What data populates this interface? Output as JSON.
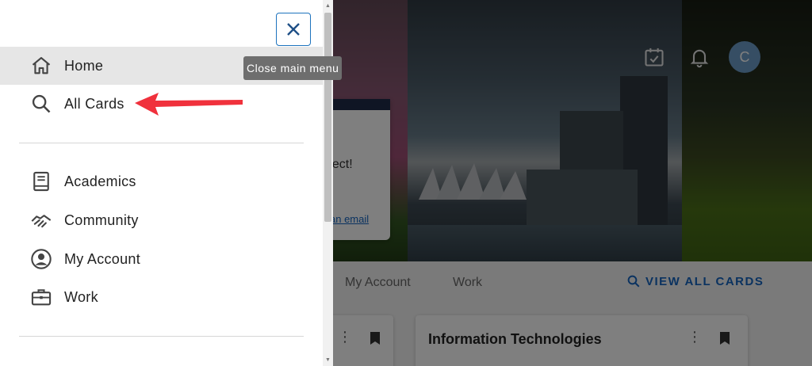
{
  "drawer": {
    "close_tooltip": "Close main menu",
    "items": [
      {
        "label": "Home",
        "icon": "home-icon"
      },
      {
        "label": "All Cards",
        "icon": "search-icon"
      },
      {
        "label": "Academics",
        "icon": "book-icon"
      },
      {
        "label": "Community",
        "icon": "handshake-icon"
      },
      {
        "label": "My Account",
        "icon": "account-circle-icon"
      },
      {
        "label": "Work",
        "icon": "briefcase-icon"
      }
    ]
  },
  "background": {
    "connect_fragment": "nect!",
    "email_fragment": "an email",
    "avatar_initial": "C",
    "tabs": [
      "My Account",
      "Work"
    ],
    "view_all_label": "VIEW ALL CARDS",
    "card_title": "Information Technologies"
  },
  "colors": {
    "accent": "#1565c0",
    "annotation_arrow": "#f0313c",
    "active_item_bg": "#e6e6e6"
  }
}
